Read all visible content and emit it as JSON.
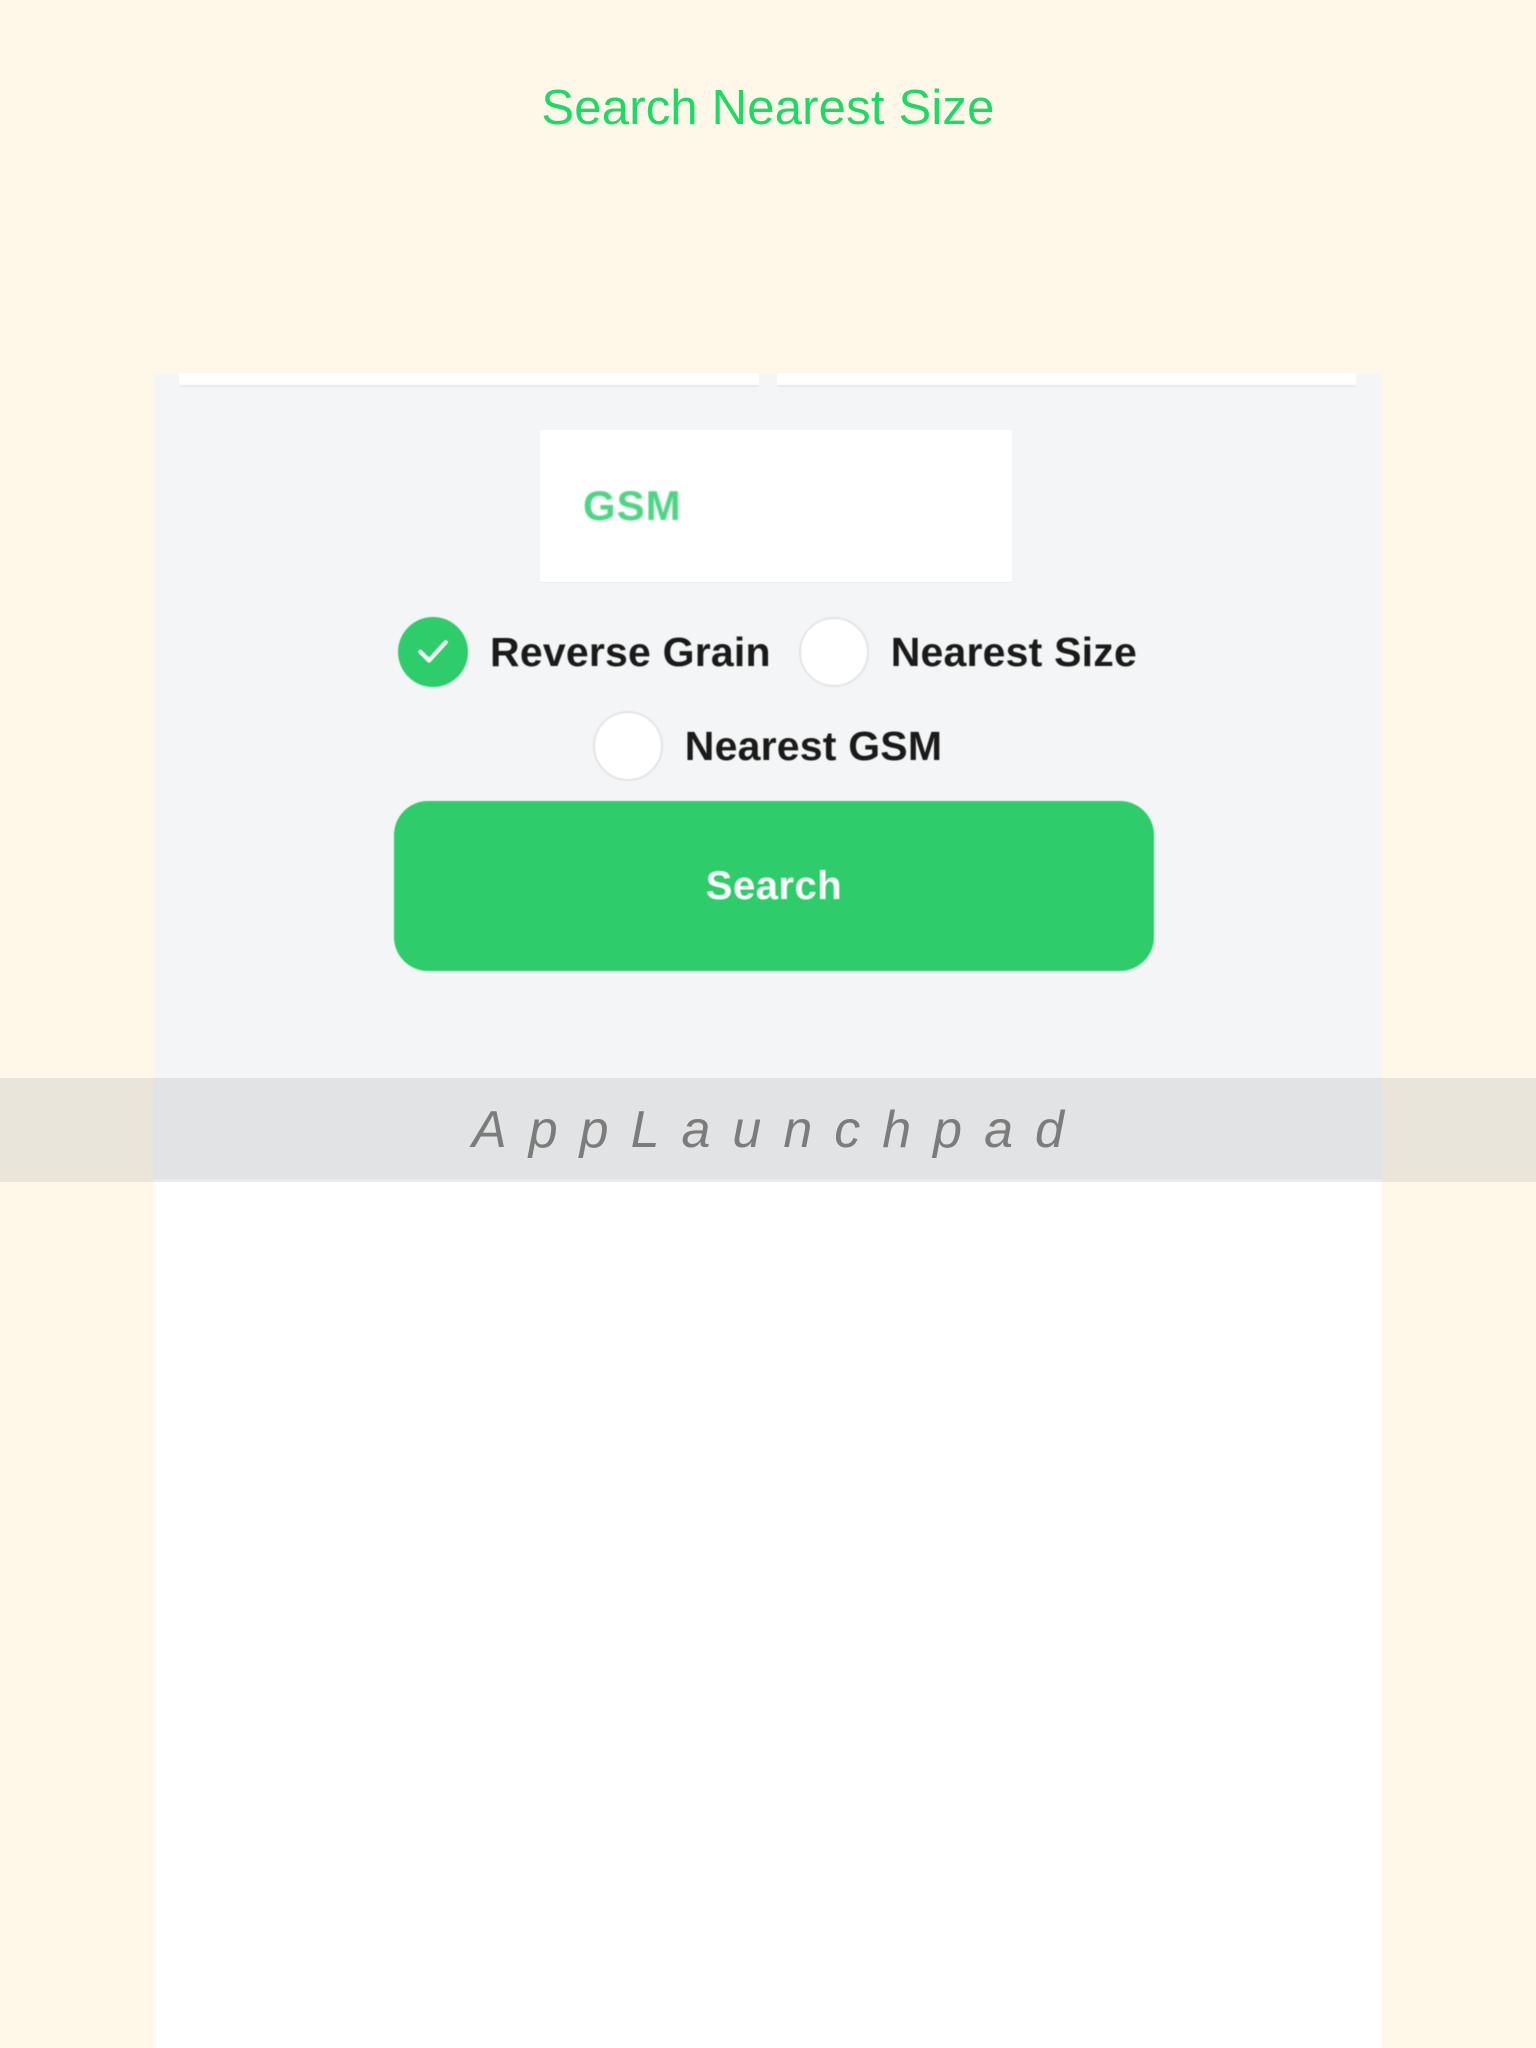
{
  "page": {
    "title": "Search Nearest Size",
    "background_color": "#FFF8E8",
    "accent_color": "#1FD966"
  },
  "form": {
    "card_background": "#F4F5F6",
    "gsm_field": {
      "value": "",
      "placeholder": "GSM",
      "placeholder_color": "#4ED584"
    },
    "options": [
      {
        "label": "Reverse Grain",
        "checked": true,
        "icon": "checkbox-checked-icon"
      },
      {
        "label": "Nearest Size",
        "checked": false,
        "icon": "checkbox-unchecked-icon"
      },
      {
        "label": "Nearest GSM",
        "checked": false,
        "icon": "checkbox-unchecked-icon"
      }
    ],
    "search_button": {
      "label": "Search",
      "color": "#2ECC6A",
      "text_color": "#FFFFFF"
    }
  },
  "watermark": {
    "text": "AppLaunchpad"
  }
}
